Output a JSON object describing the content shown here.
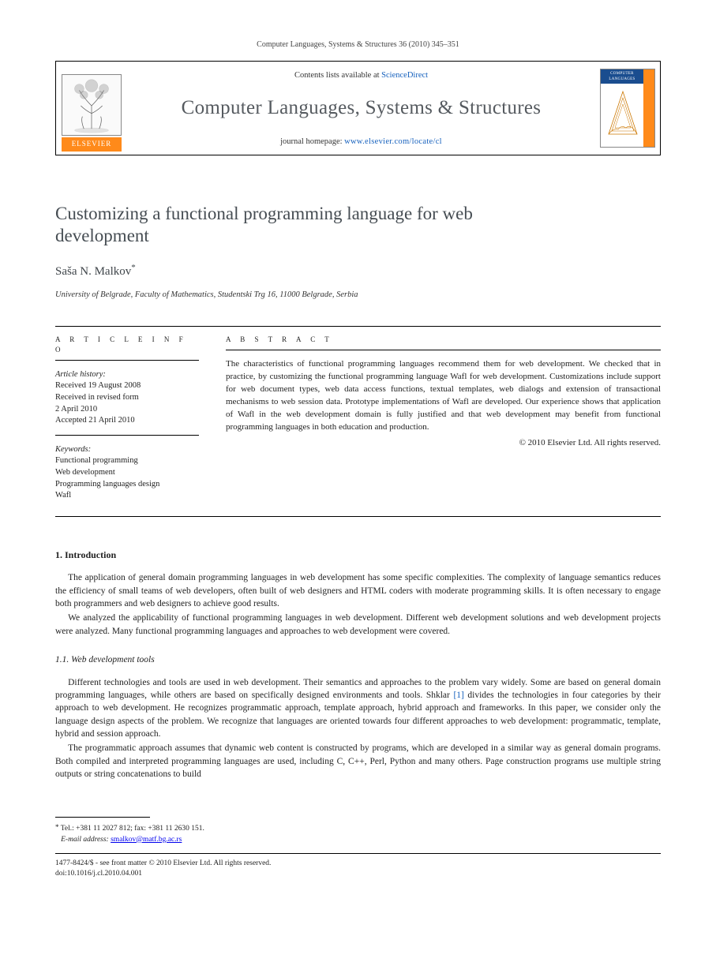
{
  "citation": "Computer Languages, Systems & Structures 36 (2010) 345–351",
  "masthead": {
    "contents_prefix": "Contents lists available at ",
    "contents_link": "ScienceDirect",
    "journal": "Computer Languages, Systems & Structures",
    "homepage_prefix": "journal homepage: ",
    "homepage_url": "www.elsevier.com/locate/cl",
    "publisher": "ELSEVIER",
    "cover_label": "COMPUTER LANGUAGES"
  },
  "paper": {
    "title": "Customizing a functional programming language for web development",
    "author": "Saša N. Malkov",
    "star": "*",
    "affiliation": "University of Belgrade, Faculty of Mathematics, Studentski Trg 16, 11000 Belgrade, Serbia"
  },
  "info": {
    "article_info_heading": "A R T I C L E   I N F O",
    "abstract_heading": "A B S T R A C T",
    "history_label": "Article history:",
    "history": "Received 19 August 2008\nReceived in revised form\n2 April 2010\nAccepted 21 April 2010",
    "keywords_label": "Keywords:",
    "keywords": "Functional programming\nWeb development\nProgramming languages design\nWafl",
    "abstract": "The characteristics of functional programming languages recommend them for web development. We checked that in practice, by customizing the functional programming language Wafl for web development. Customizations include support for web document types, web data access functions, textual templates, web dialogs and extension of transactional mechanisms to web session data. Prototype implementations of Wafl are developed. Our experience shows that application of Wafl in the web development domain is fully justified and that web development may benefit from functional programming languages in both education and production.",
    "copyright": "© 2010 Elsevier Ltd. All rights reserved."
  },
  "sections": {
    "s1_heading": "1.  Introduction",
    "s1p1": "The application of general domain programming languages in web development has some specific complexities. The complexity of language semantics reduces the efficiency of small teams of web developers, often built of web designers and HTML coders with moderate programming skills. It is often necessary to engage both programmers and web designers to achieve good results.",
    "s1p2": "We analyzed the applicability of functional programming languages in web development. Different web development solutions and web development projects were analyzed. Many functional programming languages and approaches to web development were covered.",
    "s11_heading": "1.1.  Web development tools",
    "s11p1a": "Different technologies and tools are used in web development. Their semantics and approaches to the problem vary widely. Some are based on general domain programming languages, while others are based on specifically designed environments and tools. Shklar ",
    "s11_ref": "[1]",
    "s11p1b": " divides the technologies in four categories by their approach to web development. He recognizes programmatic approach, template approach, hybrid approach and frameworks. In this paper, we consider only the language design aspects of the problem. We recognize that languages are oriented towards four different approaches to web development: programmatic, template, hybrid and session approach.",
    "s11p2": "The programmatic approach assumes that dynamic web content is constructed by programs, which are developed in a similar way as general domain programs. Both compiled and interpreted programming languages are used, including C, C++, Perl, Python and many others. Page construction programs use multiple string outputs or string concatenations to build"
  },
  "footnote": {
    "star": "*",
    "tel": "Tel.: +381 11 2027 812; fax: +381 11 2630 151.",
    "email_label": "E-mail address:",
    "email": "smalkov@matf.bg.ac.rs"
  },
  "footer": {
    "line1": "1477-8424/$ - see front matter © 2010 Elsevier Ltd. All rights reserved.",
    "line2": "doi:10.1016/j.cl.2010.04.001"
  }
}
